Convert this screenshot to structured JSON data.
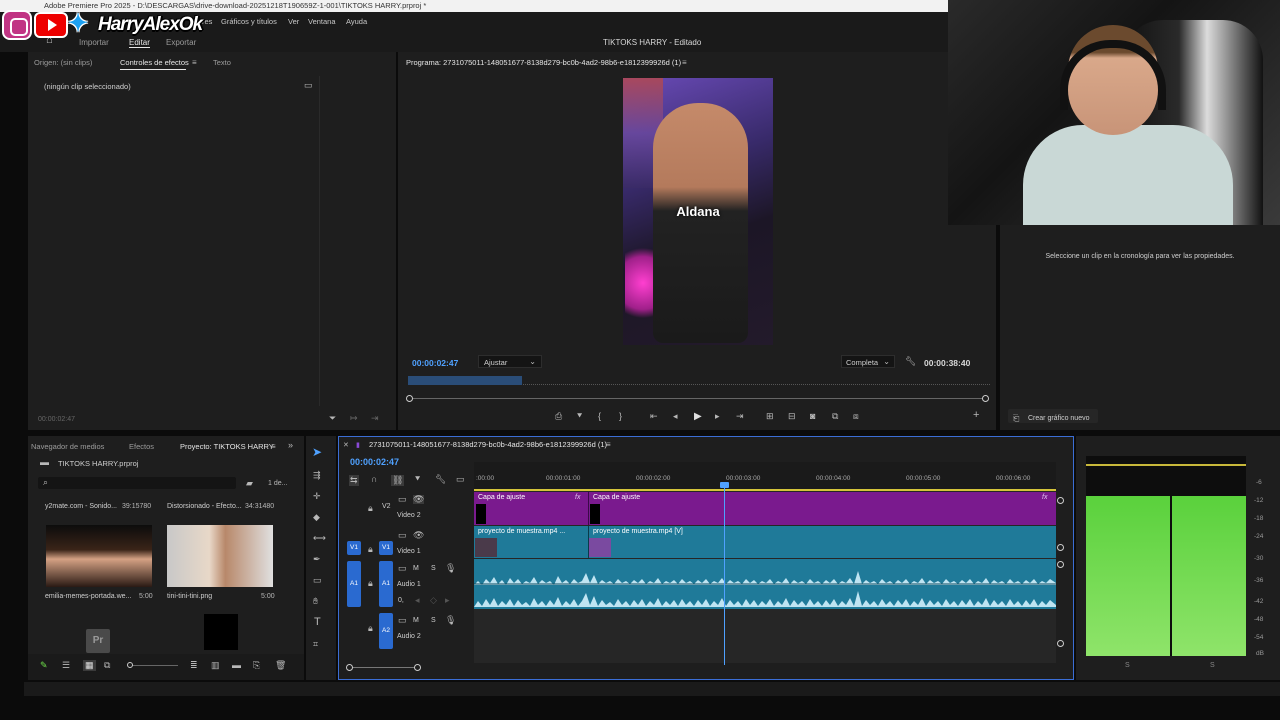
{
  "window": {
    "title": "Adobe Premiere Pro 2025 - D:\\DESCARGAS\\drive-download-20251218T190659Z-1-001\\TIKTOKS HARRY.prproj *",
    "menu": [
      "res",
      "Gráficos y títulos",
      "Ver",
      "Ventana",
      "Ayuda"
    ],
    "workspaces": [
      "Importar",
      "Editar",
      "Exportar"
    ],
    "doc_title": "TIKTOKS HARRY - Editado"
  },
  "overlay": {
    "name": "HarryAlexOk",
    "icons": [
      "instagram-icon",
      "youtube-icon",
      "twitter-icon"
    ]
  },
  "effects_panel": {
    "tabs": [
      "Origen: (sin clips)",
      "Controles de efectos",
      "Texto"
    ],
    "empty": "(ningún clip seleccionado)",
    "timecode": "00:00:02:47"
  },
  "program": {
    "title": "Programa: 2731075011-148051677-8138d279-bc0b-4ad2-98b6-e1812399926d (1)",
    "caption": "Aldana",
    "timecode": "00:00:02:47",
    "fit": "Ajustar",
    "quality": "Completa",
    "duration": "00:00:38:40"
  },
  "properties": {
    "message": "Seleccione un clip en la cronología para ver las propiedades.",
    "new_graphic": "Crear gráfico nuevo"
  },
  "project": {
    "tabs": [
      "Navegador de medios",
      "Efectos",
      "Proyecto: TIKTOKS HARRY"
    ],
    "file": "TIKTOKS HARRY.prproj",
    "count": "1 de...",
    "items": [
      {
        "name": "y2mate.com - Sonido...",
        "duration": "39:15780"
      },
      {
        "name": "Distorsionado - Efecto...",
        "duration": "34:31480"
      },
      {
        "name": "emilia-memes-portada.we...",
        "duration": "5:00"
      },
      {
        "name": "tini-tini-tini.png",
        "duration": "5:00"
      }
    ]
  },
  "timeline": {
    "sequence": "2731075011-148051677-8138d279-bc0b-4ad2-98b6-e1812399926d (1)",
    "timecode": "00:00:02:47",
    "ruler": [
      ":00:00",
      "00:00:01:00",
      "00:00:02:00",
      "00:00:03:00",
      "00:00:04:00",
      "00:00:05:00",
      "00:00:06:00"
    ],
    "tracks": [
      {
        "id": "V2",
        "name": "Video 2"
      },
      {
        "id": "V1",
        "name": "Video 1"
      },
      {
        "id": "A1",
        "name": "Audio 1"
      },
      {
        "id": "A2",
        "name": "Audio 2"
      }
    ],
    "clips": {
      "adj1": "Capa de ajuste",
      "adj2": "Capa de ajuste",
      "vid1": "proyecto de muestra.mp4 ...",
      "vid2": "proyecto de muestra.mp4 [V]"
    },
    "audio_labels": {
      "m": "M",
      "s": "S",
      "zero": "0,"
    }
  },
  "meters": {
    "scale": [
      "-6",
      "-12",
      "-18",
      "-24",
      "-30",
      "-36",
      "-42",
      "-48",
      "-54",
      "dB"
    ],
    "channels": [
      "S",
      "S"
    ]
  },
  "colors": {
    "accent": "#4fa1ff",
    "purple_clip": "#7a1a8e",
    "teal_clip": "#1f7a99",
    "meter_green": "#6ee04a"
  }
}
